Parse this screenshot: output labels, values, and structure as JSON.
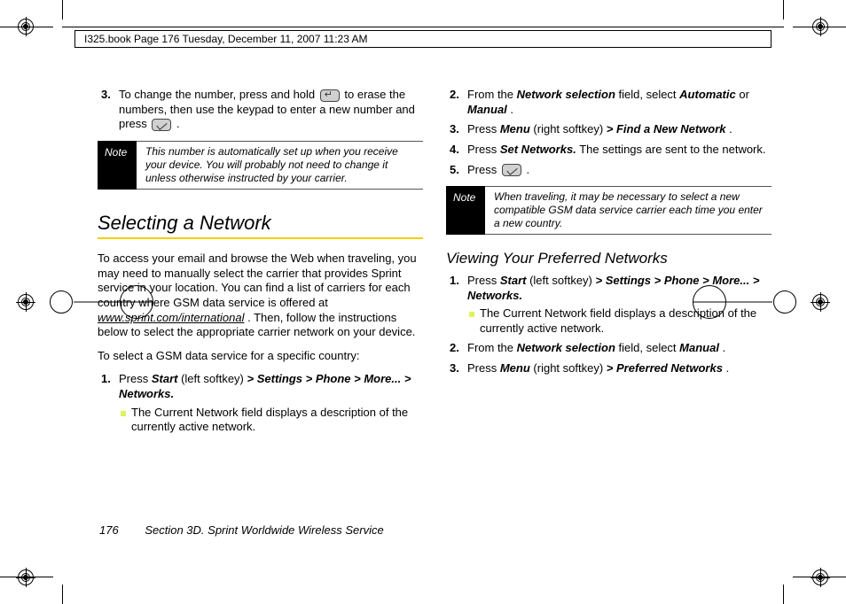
{
  "header_line": "I325.book  Page 176  Tuesday, December 11, 2007  11:23 AM",
  "left": {
    "step3_a": "To change the number, press and hold ",
    "step3_b": " to erase the numbers, then use the keypad to enter a new number and press ",
    "step3_c": ".",
    "note_label": "Note",
    "note_text": "This number is automatically set up when you receive your device. You will probably not need to change it unless otherwise instructed by your carrier.",
    "h2": "Selecting a Network",
    "para1_a": "To access your email and browse the Web when traveling, you may need to manually select the carrier that provides Sprint service in your location. You can find a list of carriers for each country where GSM data service is offered at ",
    "para1_link": "www.sprint.com/international",
    "para1_b": ". Then, follow the instructions below to select the appropriate carrier network on your device.",
    "para2": "To select a GSM data service for a specific country:",
    "s1_a": "Press ",
    "s1_b": "Start",
    "s1_c": " (left softkey) ",
    "s1_d": "> Settings > Phone > More... > Networks.",
    "s1_sub": "The Current Network field displays a description of the currently active network."
  },
  "right": {
    "s2_a": "From the ",
    "s2_b": "Network selection",
    "s2_c": " field, select ",
    "s2_d": "Automatic",
    "s2_e": " or ",
    "s2_f": "Manual",
    "s2_g": ".",
    "s3_a": "Press ",
    "s3_b": "Menu",
    "s3_c": " (right softkey) ",
    "s3_d": "> Find a New Network",
    "s3_e": ".",
    "s4_a": "Press ",
    "s4_b": "Set Networks.",
    "s4_c": " The settings are sent to the network.",
    "s5_a": "Press ",
    "s5_b": ".",
    "note_label": "Note",
    "note_text": "When traveling, it may be necessary to select a new compatible GSM data service carrier each time you enter a new country.",
    "h3": "Viewing Your Preferred Networks",
    "v1_a": "Press ",
    "v1_b": "Start",
    "v1_c": " (left softkey) ",
    "v1_d": "> Settings > Phone > More... > Networks.",
    "v1_sub": "The Current Network field displays a description of the currently active network.",
    "v2_a": "From the ",
    "v2_b": "Network selection",
    "v2_c": " field, select ",
    "v2_d": "Manual",
    "v2_e": ".",
    "v3_a": "Press ",
    "v3_b": "Menu",
    "v3_c": " (right softkey) ",
    "v3_d": "> Preferred Networks",
    "v3_e": "."
  },
  "footer": {
    "page": "176",
    "section": "Section 3D. Sprint Worldwide Wireless Service"
  },
  "nums": {
    "n1": "1.",
    "n2": "2.",
    "n3": "3.",
    "n4": "4.",
    "n5": "5."
  }
}
